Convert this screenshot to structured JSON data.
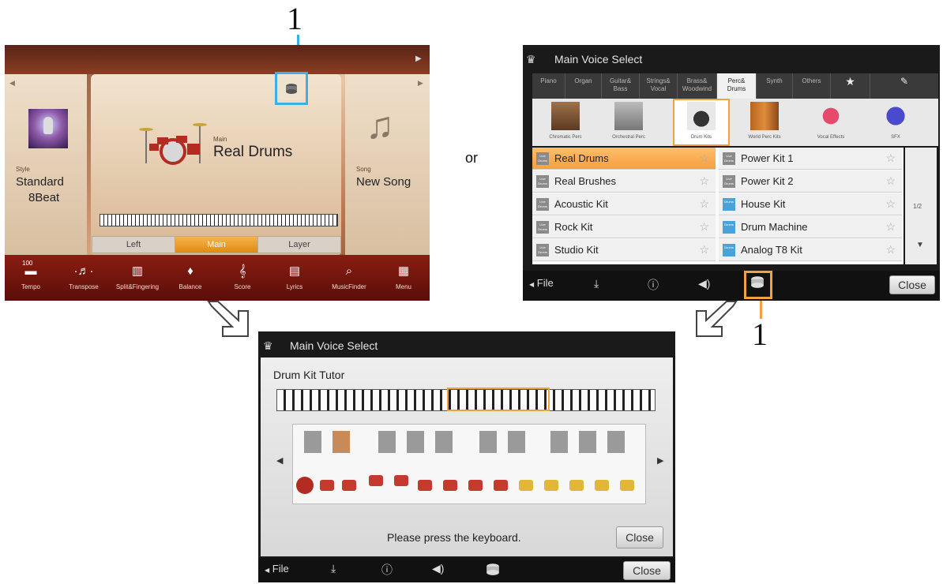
{
  "callouts": {
    "top": "1",
    "bottom": "1",
    "or": "or"
  },
  "home": {
    "style_label": "Style",
    "style_name_line1": "Standard",
    "style_name_line2": "8Beat",
    "main_label": "Main",
    "voice_name": "Real Drums",
    "song_label": "Song",
    "song_name": "New Song",
    "parts": [
      "Left",
      "Main",
      "Layer"
    ],
    "tempo_value": "100",
    "dock": [
      {
        "label": "Tempo",
        "icon": "tempo-icon"
      },
      {
        "label": "Transpose",
        "icon": "transpose-icon"
      },
      {
        "label": "Split&Fingering",
        "icon": "split-icon"
      },
      {
        "label": "Balance",
        "icon": "balance-icon"
      },
      {
        "label": "Score",
        "icon": "score-icon"
      },
      {
        "label": "Lyrics",
        "icon": "lyrics-icon"
      },
      {
        "label": "MusicFinder",
        "icon": "musicfinder-icon"
      },
      {
        "label": "Menu",
        "icon": "menu-grid-icon"
      }
    ]
  },
  "voice_select": {
    "title": "Main Voice Select",
    "categories": [
      [
        "Piano"
      ],
      [
        "Organ"
      ],
      [
        "Guitar&",
        "Bass"
      ],
      [
        "Strings&",
        "Vocal"
      ],
      [
        "Brass&",
        "Woodwind"
      ],
      [
        "Perc&",
        "Drums"
      ],
      [
        "Synth"
      ],
      [
        "Others"
      ]
    ],
    "active_category": "Perc& Drums",
    "subcategories": [
      "Chromatic Perc",
      "Orchestral Perc",
      "Drum Kits",
      "World Perc Kits",
      "Vocal Effects",
      "SFX"
    ],
    "active_subcategory": "Drum Kits",
    "voices_left": [
      "Real Drums",
      "Real Brushes",
      "Acoustic Kit",
      "Rock Kit",
      "Studio Kit"
    ],
    "voices_right": [
      "Power Kit 1",
      "Power Kit 2",
      "House Kit",
      "Drum Machine",
      "Analog T8 Kit"
    ],
    "badge_live": "Live Drums",
    "badge_drums": "Drums",
    "page": "1/2",
    "file_label": "File",
    "close_label": "Close"
  },
  "tutor": {
    "title": "Main Voice Select",
    "heading": "Drum Kit Tutor",
    "prompt": "Please press the keyboard.",
    "close_label": "Close",
    "file_label": "File",
    "bottom_close_label": "Close"
  }
}
